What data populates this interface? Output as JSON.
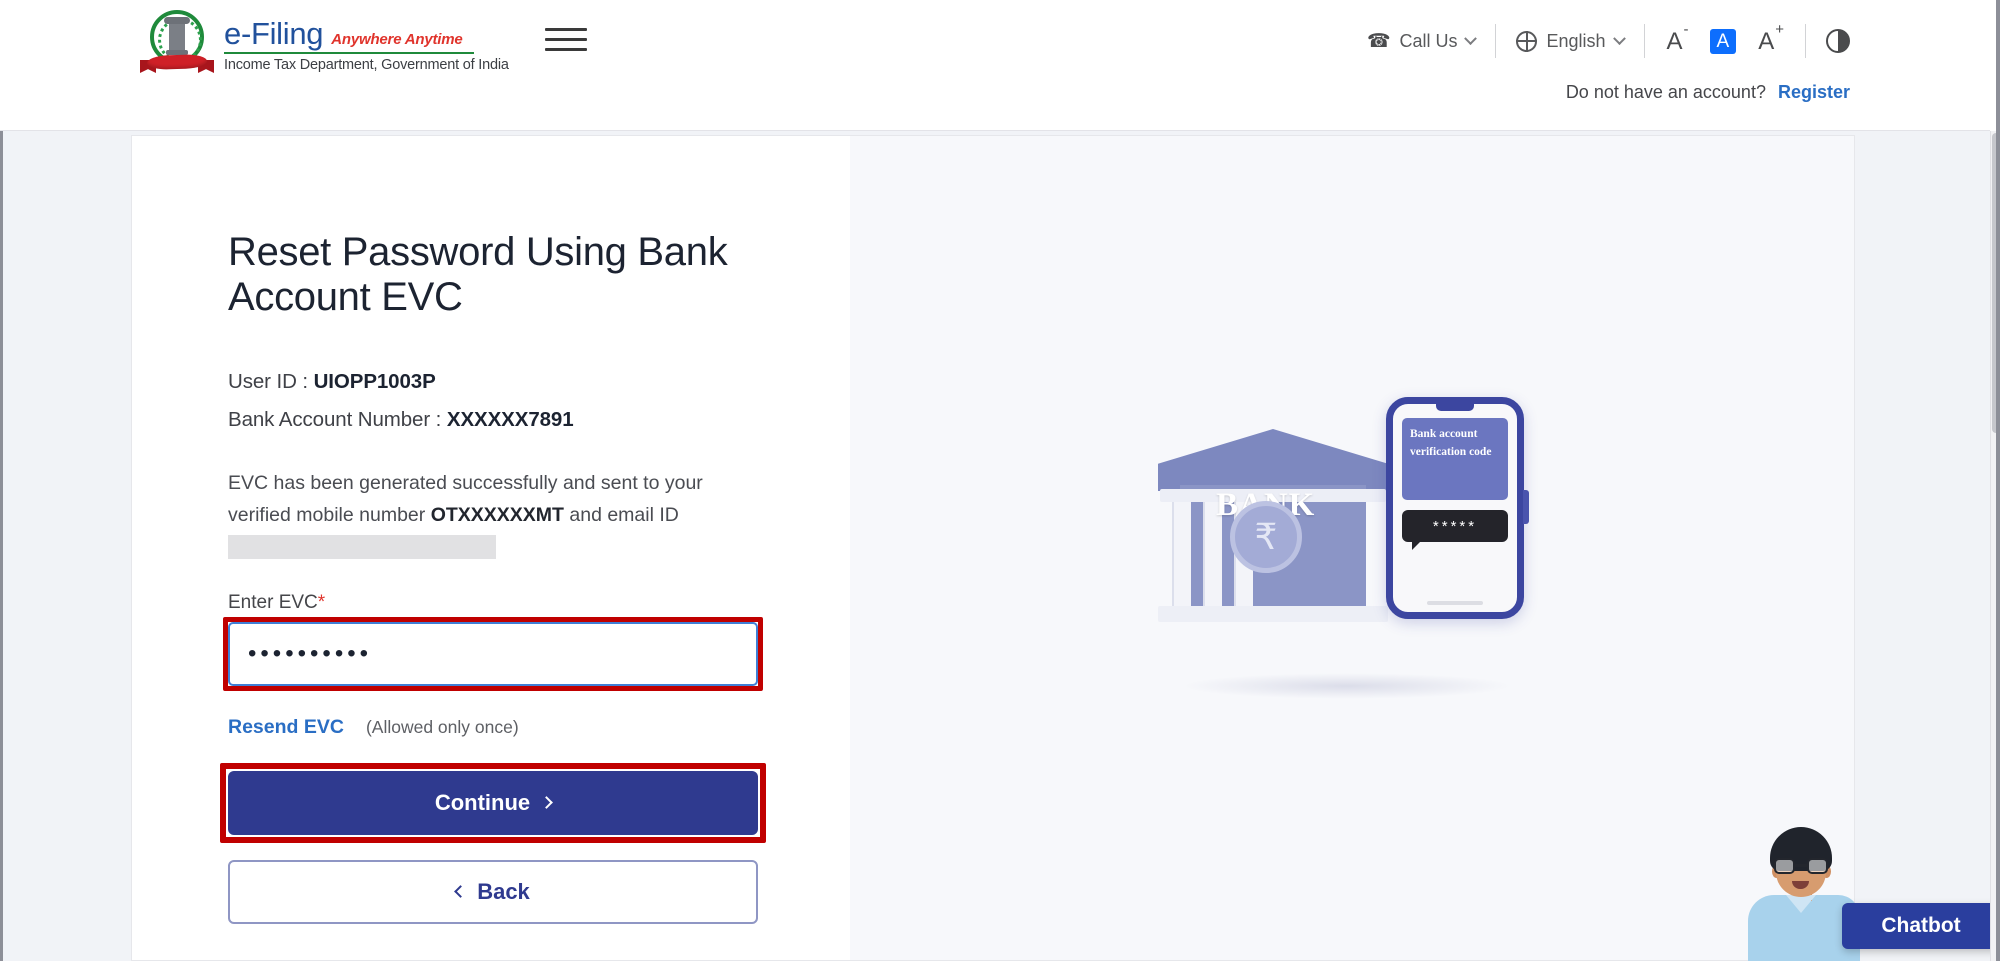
{
  "header": {
    "brand": {
      "name": "e-Filing",
      "tagline": "Anywhere Anytime",
      "department": "Income Tax Department, Government of India"
    },
    "call_us": "Call Us",
    "language": "English",
    "font_decrease": "A",
    "font_decrease_sup": "-",
    "font_normal": "A",
    "font_increase": "A",
    "font_increase_sup": "+",
    "account_prompt": "Do not have an account?",
    "register": "Register"
  },
  "form": {
    "title": "Reset Password Using Bank Account EVC",
    "user_id_label": "User ID :",
    "user_id_value": "UIOPP1003P",
    "bank_account_label": "Bank Account Number :",
    "bank_account_value": "XXXXXX7891",
    "message_part1": "EVC has been generated successfully and sent to your verified mobile number ",
    "message_mobile": "OTXXXXXXMT",
    "message_part2": " and email ID",
    "evc_label": "Enter EVC",
    "evc_required_mark": "*",
    "evc_value": "••••••••••",
    "evc_placeholder": "",
    "resend_link": "Resend EVC",
    "resend_note": "(Allowed only once)",
    "continue_label": "Continue",
    "back_label": "Back"
  },
  "illustration": {
    "bank_word": "BANK",
    "rupee_symbol": "₹",
    "phone_message": "Bank account verification code",
    "sms_code": "*****"
  },
  "chatbot": {
    "label": "Chatbot"
  },
  "colors": {
    "brand_blue": "#21519c",
    "brand_red": "#e0342c",
    "brand_green": "#1f8a3b",
    "primary_button": "#2f3a8f",
    "link": "#2a6ec4",
    "annotation": "#c00000",
    "accent_highlight": "#0d6efd"
  }
}
